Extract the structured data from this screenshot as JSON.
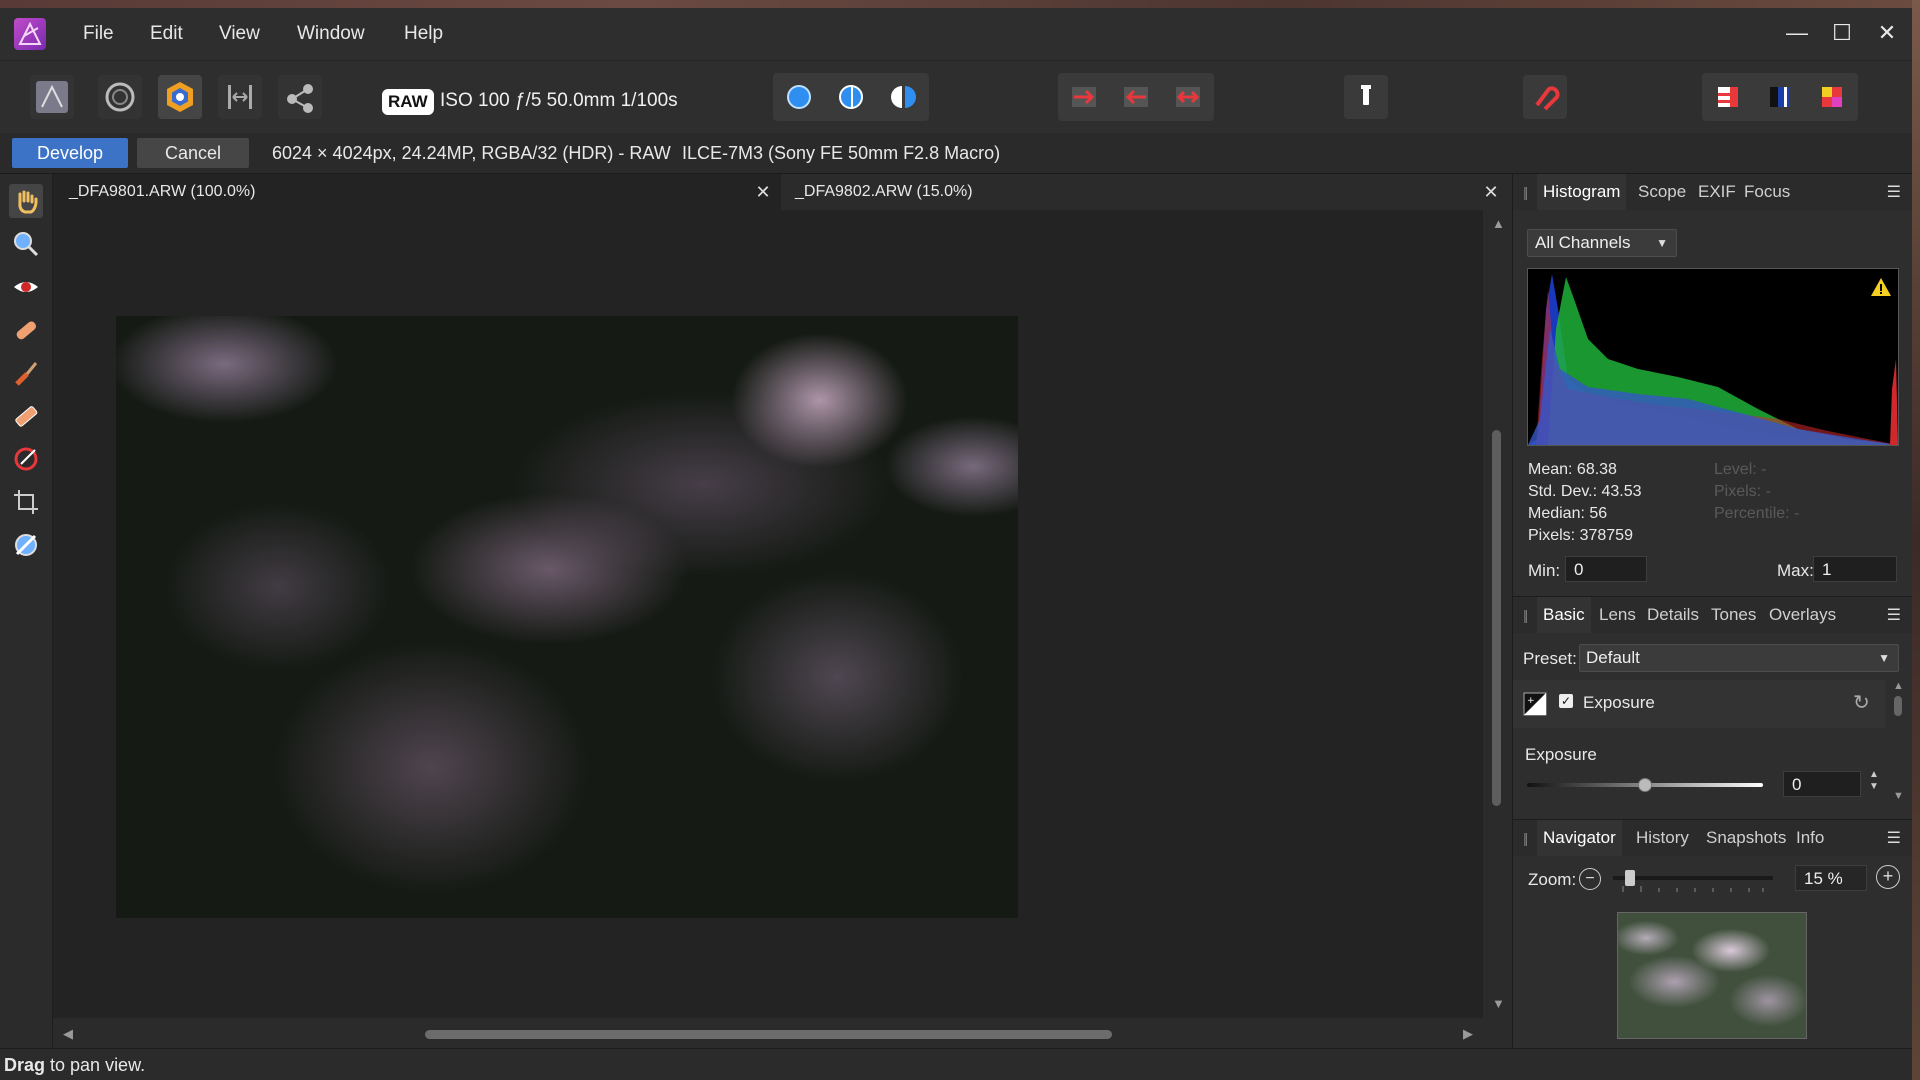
{
  "app": {
    "menu": [
      "File",
      "Edit",
      "View",
      "Window",
      "Help"
    ],
    "window_controls": {
      "minimize": "—",
      "maximize": "☐",
      "close": "✕"
    }
  },
  "toolbar": {
    "raw_badge": "RAW",
    "camera_info": "ISO 100 ƒ/5 50.0mm 1/100s"
  },
  "context_bar": {
    "develop_label": "Develop",
    "cancel_label": "Cancel",
    "image_info": "6024 × 4024px, 24.24MP, RGBA/32 (HDR) - RAW",
    "lens_info": "ILCE-7M3 (Sony FE 50mm F2.8 Macro)"
  },
  "documents": {
    "tabs": [
      {
        "label": "_DFA9801.ARW (100.0%)",
        "active": true
      },
      {
        "label": "_DFA9802.ARW (15.0%)",
        "active": false
      }
    ]
  },
  "status": {
    "bold": "Drag",
    "rest": " to pan view."
  },
  "histogram_panel": {
    "tabs": [
      "Histogram",
      "Scope",
      "EXIF",
      "Focus"
    ],
    "channel": "All Channels",
    "stats": {
      "mean": "Mean: 68.38",
      "std_dev": "Std. Dev.: 43.53",
      "median": "Median: 56",
      "pixels": "Pixels: 378759",
      "level": "Level: -",
      "pixels_sel": "Pixels: -",
      "percentile": "Percentile: -"
    },
    "min_label": "Min:",
    "min_value": "0",
    "max_label": "Max:",
    "max_value": "1"
  },
  "adjust_panel": {
    "tabs": [
      "Basic",
      "Lens",
      "Details",
      "Tones",
      "Overlays"
    ],
    "preset_label": "Preset:",
    "preset_value": "Default",
    "section_label": "Exposure",
    "exposure_label": "Exposure",
    "exposure_value": "0",
    "exposure_slider_fraction": 0.5
  },
  "nav_panel": {
    "tabs": [
      "Navigator",
      "History",
      "Snapshots",
      "Info"
    ],
    "zoom_label": "Zoom:",
    "zoom_value": "15 %"
  },
  "colors": {
    "accent": "#3d73c6",
    "panel_bg": "#2e2e2e",
    "canvas_bg": "#232323"
  }
}
